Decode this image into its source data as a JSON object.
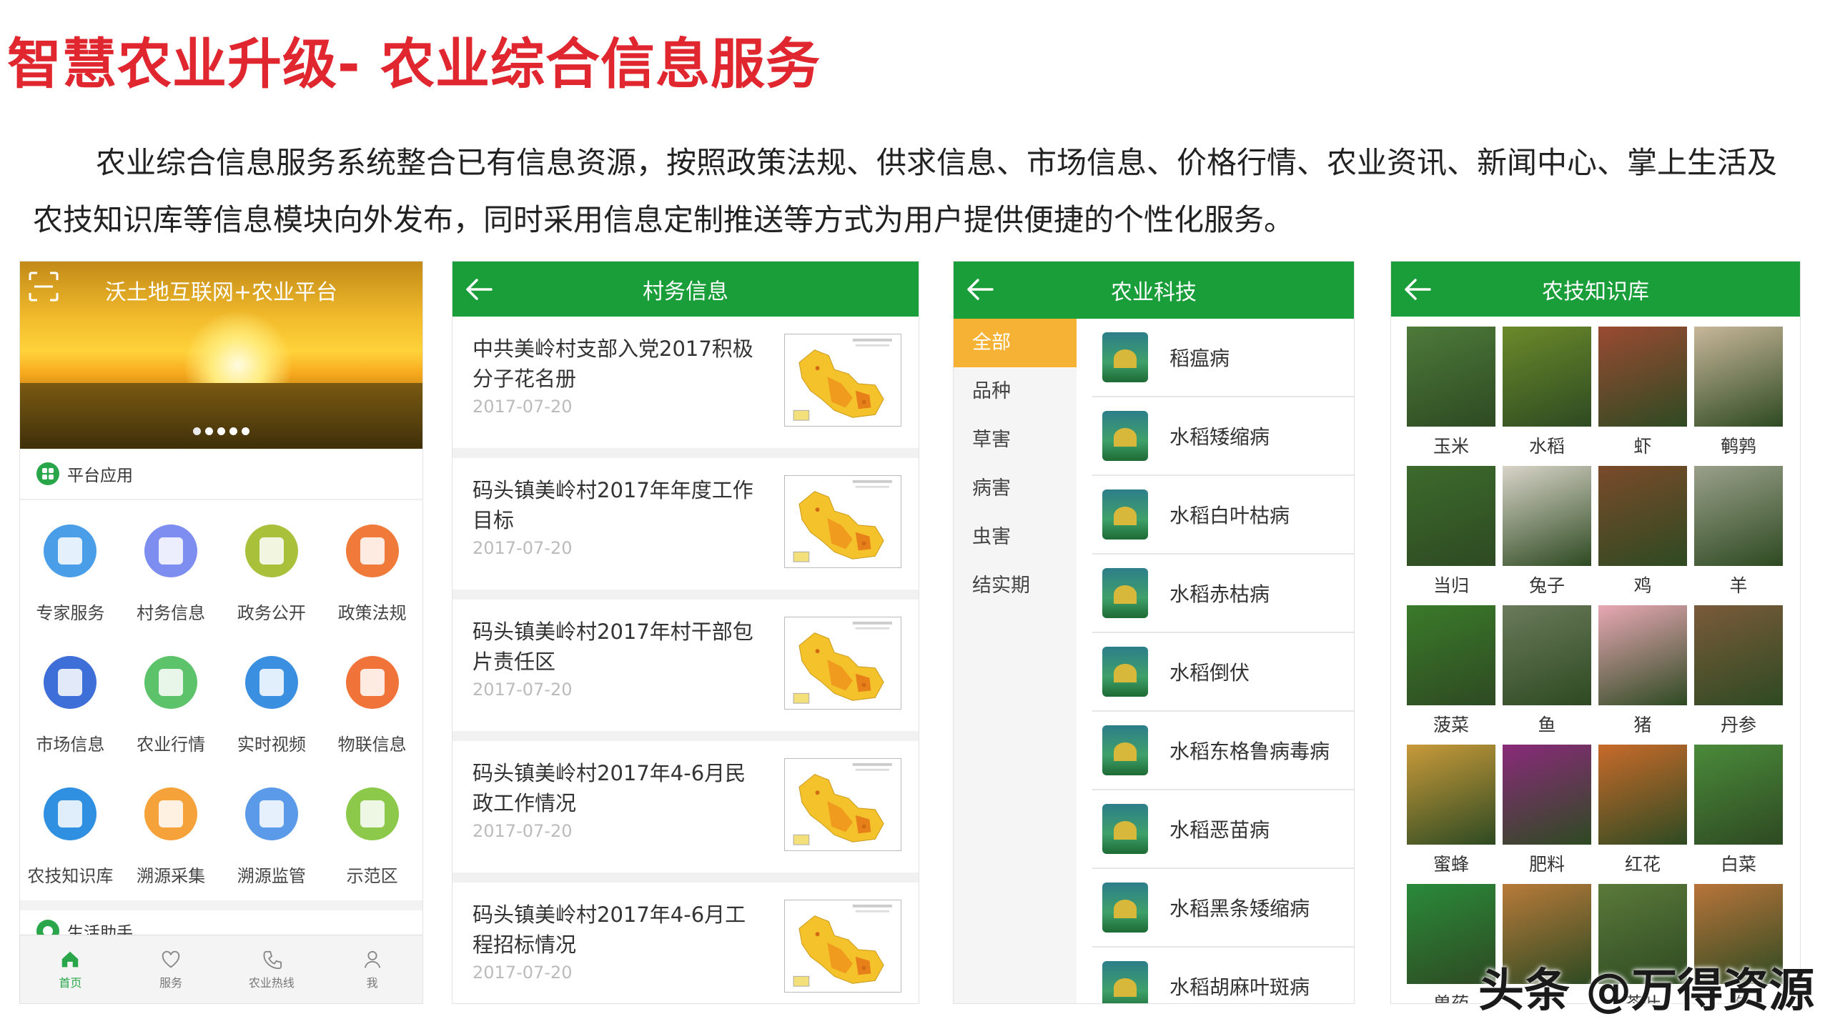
{
  "title": "智慧农业升级- 农业综合信息服务",
  "intro": "农业综合信息服务系统整合已有信息资源，按照政策法规、供求信息、市场信息、价格行情、农业资讯、新闻中心、掌上生活及农技知识库等信息模块向外发布，同时采用信息定制推送等方式为用户提供便捷的个性化服务。",
  "phone1": {
    "banner_title": "沃土地互联网+农业平台",
    "platform_section": "平台应用",
    "apps": [
      {
        "label": "专家服务",
        "color": "#4a9ee8"
      },
      {
        "label": "村务信息",
        "color": "#7e8ef0"
      },
      {
        "label": "政务公开",
        "color": "#a8c03a"
      },
      {
        "label": "政策法规",
        "color": "#f07a3a"
      },
      {
        "label": "市场信息",
        "color": "#3e6fd8"
      },
      {
        "label": "农业行情",
        "color": "#5cc36a"
      },
      {
        "label": "实时视频",
        "color": "#3a8fe0"
      },
      {
        "label": "物联信息",
        "color": "#f0743a"
      },
      {
        "label": "农技知识库",
        "color": "#2f8fe0"
      },
      {
        "label": "溯源采集",
        "color": "#f6a23a"
      },
      {
        "label": "溯源监管",
        "color": "#5a9ae8"
      },
      {
        "label": "示范区",
        "color": "#8cc84a"
      }
    ],
    "life_section": "生活助手",
    "tabs": [
      "首页",
      "服务",
      "农业热线",
      "我"
    ]
  },
  "phone2": {
    "title": "村务信息",
    "news": [
      {
        "title": "中共美岭村支部入党2017积极分子花名册",
        "date": "2017-07-20"
      },
      {
        "title": "码头镇美岭村2017年年度工作目标",
        "date": "2017-07-20"
      },
      {
        "title": "码头镇美岭村2017年村干部包片责任区",
        "date": "2017-07-20"
      },
      {
        "title": "码头镇美岭村2017年4-6月民政工作情况",
        "date": "2017-07-20"
      },
      {
        "title": "码头镇美岭村2017年4-6月工程招标情况",
        "date": "2017-07-20"
      }
    ]
  },
  "phone3": {
    "title": "农业科技",
    "categories": [
      "全部",
      "品种",
      "草害",
      "病害",
      "虫害",
      "结实期"
    ],
    "items": [
      "稻瘟病",
      "水稻矮缩病",
      "水稻白叶枯病",
      "水稻赤枯病",
      "水稻倒伏",
      "水稻东格鲁病毒病",
      "水稻恶苗病",
      "水稻黑条矮缩病",
      "水稻胡麻叶斑病"
    ]
  },
  "phone4": {
    "title": "农技知识库",
    "items": [
      {
        "label": "玉米",
        "color": "#4d7a3a"
      },
      {
        "label": "水稻",
        "color": "#6b8a2a"
      },
      {
        "label": "虾",
        "color": "#9a4a32"
      },
      {
        "label": "鹌鹑",
        "color": "#c8b79a"
      },
      {
        "label": "当归",
        "color": "#3c6a2c"
      },
      {
        "label": "兔子",
        "color": "#d8d4c8"
      },
      {
        "label": "鸡",
        "color": "#7a4a2a"
      },
      {
        "label": "羊",
        "color": "#9aa08a"
      },
      {
        "label": "菠菜",
        "color": "#3a7a2a"
      },
      {
        "label": "鱼",
        "color": "#6a7a5a"
      },
      {
        "label": "猪",
        "color": "#e8a8b4"
      },
      {
        "label": "丹参",
        "color": "#7a5a3a"
      },
      {
        "label": "蜜蜂",
        "color": "#c89a3a"
      },
      {
        "label": "肥料",
        "color": "#8a2a7a"
      },
      {
        "label": "红花",
        "color": "#c86a2a"
      },
      {
        "label": "白菜",
        "color": "#4a8a3a"
      },
      {
        "label": "兽药",
        "color": "#2a8a3a"
      },
      {
        "label": "牛",
        "color": "#b87a3a"
      },
      {
        "label": "茶叶",
        "color": "#5a7a3a"
      },
      {
        "label": "狗",
        "color": "#b8743a"
      }
    ],
    "partial_label": "兽药"
  },
  "watermark": "头条 @万得资源"
}
